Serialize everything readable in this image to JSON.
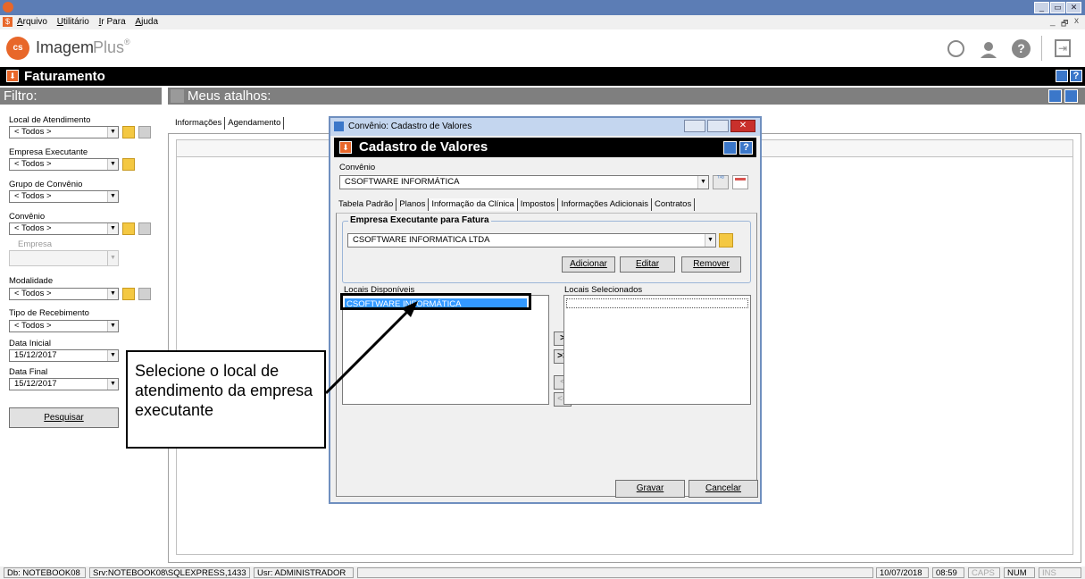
{
  "window": {
    "min_label": "_",
    "max_label": "▭",
    "close_label": "✕",
    "inner_min_label": "_",
    "inner_restore_label": "🗗",
    "inner_close_label": "x"
  },
  "menu": {
    "items": [
      "Arquivo",
      "Utilitário",
      "Ir Para",
      "Ajuda"
    ]
  },
  "app": {
    "logo_text": "Imagem",
    "logo_accent": "Plus",
    "logo_mark": "cs"
  },
  "module": {
    "title": "Faturamento"
  },
  "filter": {
    "header": "Filtro:",
    "local_label": "Local de Atendimento",
    "local_value": "< Todos >",
    "empresa_label": "Empresa Executante",
    "empresa_value": "< Todos >",
    "grupo_label": "Grupo de Convênio",
    "grupo_value": "< Todos >",
    "convenio_label": "Convênio",
    "convenio_value": "< Todos >",
    "empresa_sub_label": "Empresa",
    "modalidade_label": "Modalidade",
    "modalidade_value": "< Todos >",
    "tipo_label": "Tipo de Recebimento",
    "tipo_value": "< Todos >",
    "data_inicial_label": "Data Inicial",
    "data_inicial_value": "15/12/2017",
    "data_final_label": "Data Final",
    "data_final_value": "15/12/2017",
    "search_button": "Pesquisar"
  },
  "shortcuts": {
    "header": "Meus atalhos:",
    "tabs": [
      "Informações",
      "Agendamento"
    ]
  },
  "dialog": {
    "window_title": "Convênio: Cadastro de Valores",
    "header": "Cadastro de Valores",
    "convenio_label": "Convênio",
    "convenio_value": "CSOFTWARE INFORMÁTICA",
    "tabs": [
      "Tabela Padrão",
      "Planos",
      "Informação da Clínica",
      "Impostos",
      "Informações Adicionais",
      "Contratos"
    ],
    "group_title": "Empresa Executante para Fatura",
    "empresa_value": "CSOFTWARE INFORMATICA LTDA",
    "add_button": "Adicionar",
    "edit_button": "Editar",
    "remove_button": "Remover",
    "available_label": "Locais Disponíveis",
    "available_items": [
      "CSOFTWARE INFORMÁTICA"
    ],
    "selected_label": "Locais Selecionados",
    "move_one": ">",
    "move_all": ">>",
    "back_one": "<",
    "back_all": "<<",
    "save_button": "Gravar",
    "cancel_button": "Cancelar"
  },
  "annotation": {
    "text": "Selecione o local de atendimento da empresa executante"
  },
  "status": {
    "db": "Db: NOTEBOOK08",
    "srv": "Srv:NOTEBOOK08\\SQLEXPRESS,1433",
    "usr": "Usr: ADMINISTRADOR",
    "date": "10/07/2018",
    "time": "08:59",
    "caps": "CAPS",
    "num": "NUM",
    "ins": "INS"
  },
  "colors": {
    "title_bar": "#5c7db5",
    "header_black": "#000000",
    "filter_gray": "#7f7f7f",
    "highlight": "#3399ff",
    "brand_orange": "#e8672a",
    "close_red": "#c9302c"
  }
}
